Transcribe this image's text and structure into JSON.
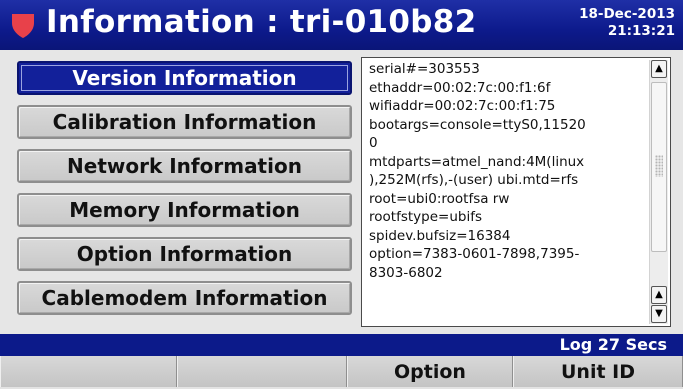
{
  "header": {
    "title": "Information : tri-010b82",
    "date": "18-Dec-2013",
    "time": "21:13:21",
    "logo_icon": "shield-heart-icon",
    "logo_color": "#e8414a"
  },
  "menu": {
    "items": [
      {
        "label": "Version Information",
        "selected": true
      },
      {
        "label": "Calibration Information",
        "selected": false
      },
      {
        "label": "Network Information",
        "selected": false
      },
      {
        "label": "Memory Information",
        "selected": false
      },
      {
        "label": "Option Information",
        "selected": false
      },
      {
        "label": "Cablemodem Information",
        "selected": false
      }
    ]
  },
  "info_panel": {
    "lines": [
      "serial#=303553",
      "ethaddr=00:02:7c:00:f1:6f",
      "wifiaddr=00:02:7c:00:f1:75",
      "bootargs=console=ttyS0,11520",
      "0",
      "mtdparts=atmel_nand:4M(linux",
      "),252M(rfs),-(user) ubi.mtd=rfs",
      "root=ubi0:rootfsa rw",
      "rootfstype=ubifs",
      "spidev.bufsiz=16384",
      "option=7383-0601-7898,7395-",
      "8303-6802"
    ],
    "scroll_up_icon": "arrow-up-icon",
    "scroll_down_icon": "arrow-down-icon"
  },
  "status_bar": {
    "text": "Log 27 Secs"
  },
  "softkeys": [
    "",
    "",
    "Option",
    "Unit ID"
  ],
  "colors": {
    "header_blue": "#0d1a8c",
    "selected_blue": "#12209a",
    "button_gray": "#d0d0d0"
  }
}
